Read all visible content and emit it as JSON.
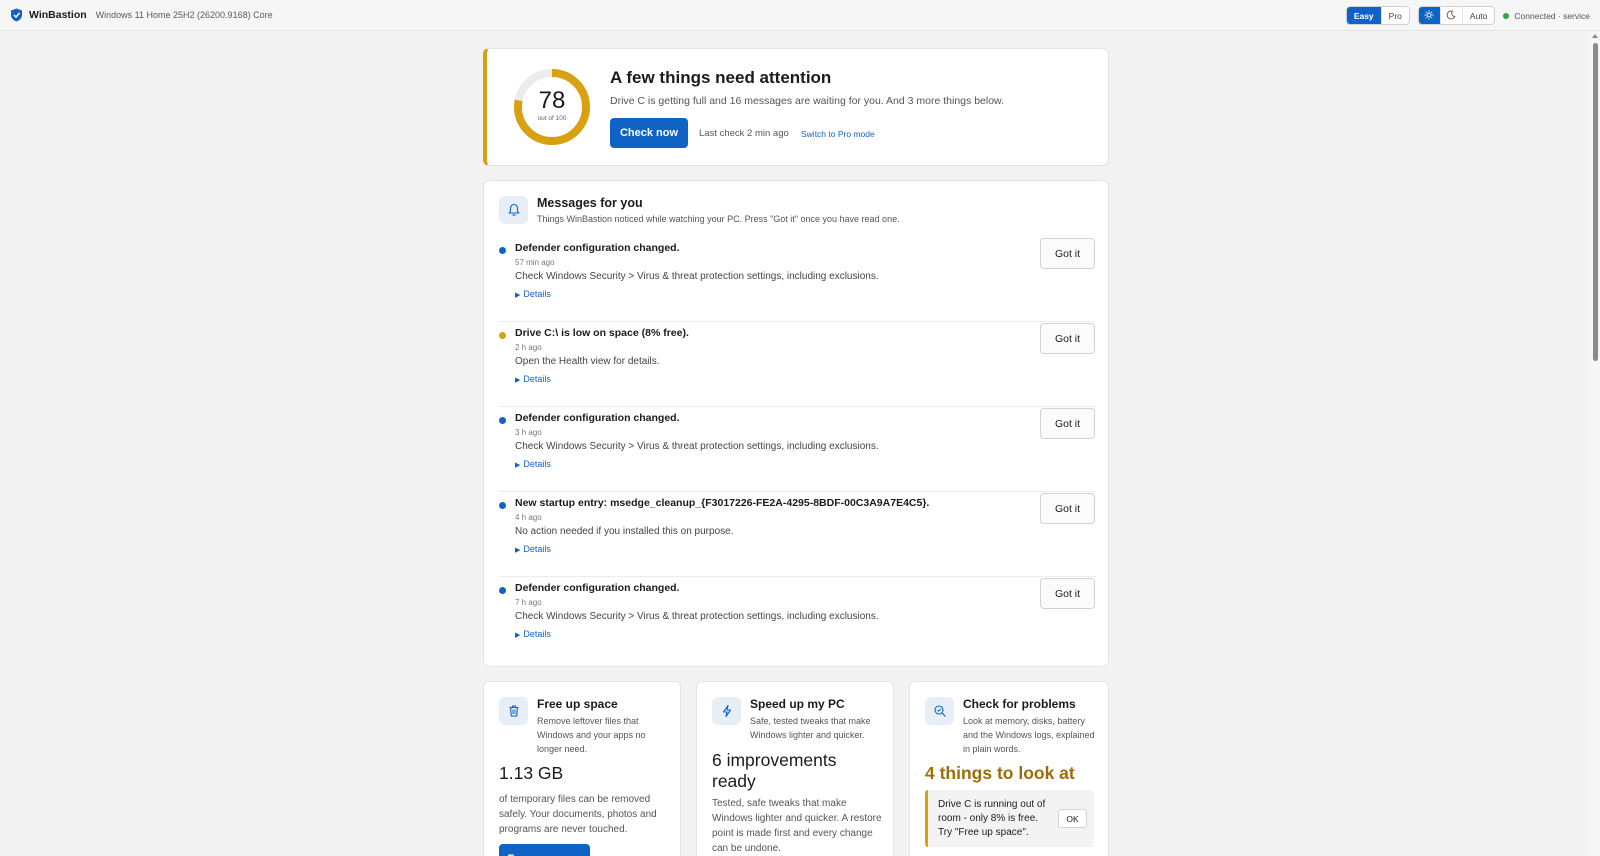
{
  "app": {
    "name": "WinBastion",
    "os_info": "Windows 11 Home 25H2 (26200.9168) Core"
  },
  "top_controls": {
    "mode_options": [
      "Easy",
      "Pro"
    ],
    "mode_selected": "Easy",
    "theme_options": [
      "light",
      "dark",
      "Auto"
    ],
    "theme_selected": "light",
    "theme_auto_label": "Auto",
    "connection_status": "Connected · service",
    "connection_color": "#29a745"
  },
  "hero": {
    "score": 78,
    "score_max": 100,
    "score_caption": "out of 100",
    "ring_color": "#d9a112",
    "title": "A few things need attention",
    "subtitle": "Drive C is getting full and 16 messages are waiting for you. And 3 more things below.",
    "check_button": "Check now",
    "last_check": "Last check 2 min ago",
    "pro_link": "Switch to Pro mode"
  },
  "messages": {
    "title": "Messages for you",
    "subtitle": "Things WinBastion noticed while watching your PC. Press \"Got it\" once you have read one.",
    "details_label": "Details",
    "ack_label": "Got it",
    "items": [
      {
        "title": "Defender configuration changed.",
        "time": "57 min ago",
        "body": "Check Windows Security > Virus & threat protection settings, including exclusions.",
        "dot_color": "#0f63c4"
      },
      {
        "title": "Drive C:\\ is low on space (8% free).",
        "time": "2 h ago",
        "body": "Open the Health view for details.",
        "dot_color": "#d9a112"
      },
      {
        "title": "Defender configuration changed.",
        "time": "3 h ago",
        "body": "Check Windows Security > Virus & threat protection settings, including exclusions.",
        "dot_color": "#0f63c4"
      },
      {
        "title": "New startup entry: msedge_cleanup_{F3017226-FE2A-4295-8BDF-00C3A9A7E4C5}.",
        "time": "4 h ago",
        "body": "No action needed if you installed this on purpose.",
        "dot_color": "#0f63c4"
      },
      {
        "title": "Defender configuration changed.",
        "time": "7 h ago",
        "body": "Check Windows Security > Virus & threat protection settings, including exclusions.",
        "dot_color": "#0f63c4"
      }
    ]
  },
  "tiles": {
    "free_space": {
      "title": "Free up space",
      "desc": "Remove leftover files that Windows and your apps no longer need.",
      "big": "1.13 GB",
      "body": "of temporary files can be removed safely. Your documents, photos and programs are never touched.",
      "button": "Free up space"
    },
    "speed_up": {
      "title": "Speed up my PC",
      "desc": "Safe, tested tweaks that make Windows lighter and quicker.",
      "big": "6 improvements ready",
      "body": "Tested, safe tweaks that make Windows lighter and quicker. A restore point is made first and every change can be undone."
    },
    "check_problems": {
      "title": "Check for problems",
      "desc": "Look at memory, disks, battery and the Windows logs, explained in plain words.",
      "big": "4 things to look at",
      "notice": "Drive C is running out of room - only 8% is free. Try \"Free up space\".",
      "ok_label": "OK"
    }
  }
}
